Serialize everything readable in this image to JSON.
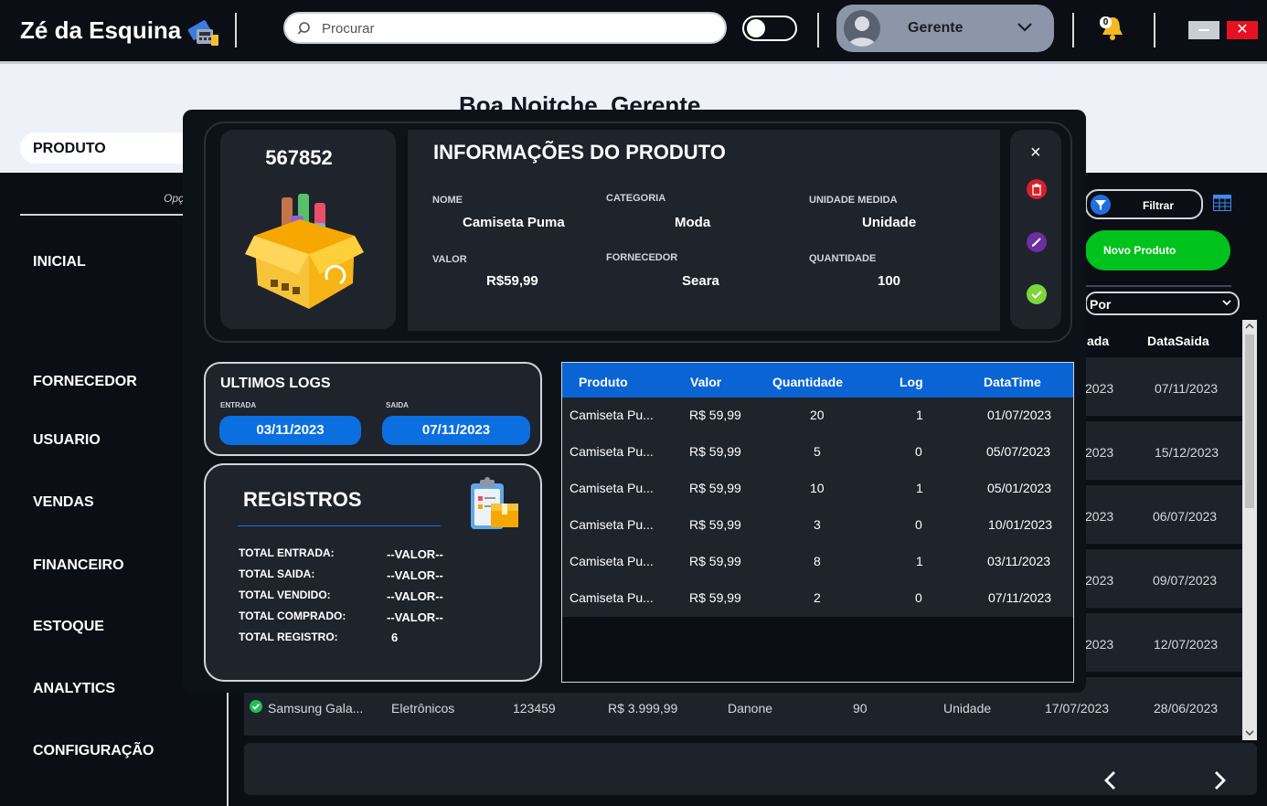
{
  "header": {
    "app_title": "Zé da Esquina",
    "search_placeholder": "Procurar",
    "user_name": "Gerente",
    "notification_count": "0"
  },
  "greeting": "Boa Noitche, Gerente",
  "sidebar": {
    "options_label": "Opç",
    "items": [
      {
        "label": "INICIAL"
      },
      {
        "label": "PRODUTO",
        "active": true
      },
      {
        "label": "FORNECEDOR"
      },
      {
        "label": "USUARIO"
      },
      {
        "label": "VENDAS"
      },
      {
        "label": "FINANCEIRO"
      },
      {
        "label": "ESTOQUE"
      },
      {
        "label": "ANALYTICS"
      },
      {
        "label": "CONFIGURAÇÃO"
      }
    ]
  },
  "toolbar": {
    "filter_label": "Filtrar",
    "new_product_label": "Novo Produto",
    "sort_label": "Por"
  },
  "background_table": {
    "headers": [
      "ada",
      "DataSaida"
    ],
    "rows": [
      [
        "2023",
        "07/11/2023"
      ],
      [
        "2023",
        "15/12/2023"
      ],
      [
        "2023",
        "06/07/2023"
      ],
      [
        "2023",
        "09/07/2023"
      ],
      [
        "2023",
        "12/07/2023"
      ]
    ],
    "last_row": [
      "Samsung Gala...",
      "Eletrônicos",
      "123459",
      "R$ 3.999,99",
      "Danone",
      "90",
      "Unidade",
      "17/07/2023",
      "28/06/2023"
    ]
  },
  "modal": {
    "product_code": "567852",
    "title": "INFORMAÇÕES DO PRODUTO",
    "fields": {
      "nome_label": "NOME",
      "nome": "Camiseta Puma",
      "categoria_label": "CATEGORIA",
      "categoria": "Moda",
      "unidade_label": "UNIDADE MEDIDA",
      "unidade": "Unidade",
      "valor_label": "VALOR",
      "valor": "R$59,99",
      "fornecedor_label": "FORNECEDOR",
      "fornecedor": "Seara",
      "quantidade_label": "QUANTIDADE",
      "quantidade": "100"
    },
    "logs": {
      "title": "ULTIMOS LOGS",
      "entrada_label": "ENTRADA",
      "entrada_date": "03/11/2023",
      "saida_label": "SAIDA",
      "saida_date": "07/11/2023"
    },
    "registros": {
      "title": "REGISTROS",
      "items": [
        {
          "label": "TOTAL ENTRADA:",
          "value": "--VALOR--"
        },
        {
          "label": "TOTAL SAIDA:",
          "value": "--VALOR--"
        },
        {
          "label": "TOTAL VENDIDO:",
          "value": "--VALOR--"
        },
        {
          "label": "TOTAL COMPRADO:",
          "value": "--VALOR--"
        },
        {
          "label": "TOTAL REGISTRO:",
          "value": "6"
        }
      ]
    },
    "log_table": {
      "headers": [
        "Produto",
        "Valor",
        "Quantidade",
        "Log",
        "DataTime"
      ],
      "rows": [
        [
          "Camiseta Pu...",
          "R$ 59,99",
          "20",
          "1",
          "01/07/2023"
        ],
        [
          "Camiseta Pu...",
          "R$ 59,99",
          "5",
          "0",
          "05/07/2023"
        ],
        [
          "Camiseta Pu...",
          "R$ 59,99",
          "10",
          "1",
          "05/01/2023"
        ],
        [
          "Camiseta Pu...",
          "R$ 59,99",
          "3",
          "0",
          "10/01/2023"
        ],
        [
          "Camiseta Pu...",
          "R$ 59,99",
          "8",
          "1",
          "03/11/2023"
        ],
        [
          "Camiseta Pu...",
          "R$ 59,99",
          "2",
          "0",
          "07/11/2023"
        ]
      ]
    }
  },
  "colors": {
    "accent_blue": "#0b64d4",
    "success_green": "#00c21c",
    "danger_red": "#e81123",
    "edit_purple": "#6b2fa0"
  }
}
